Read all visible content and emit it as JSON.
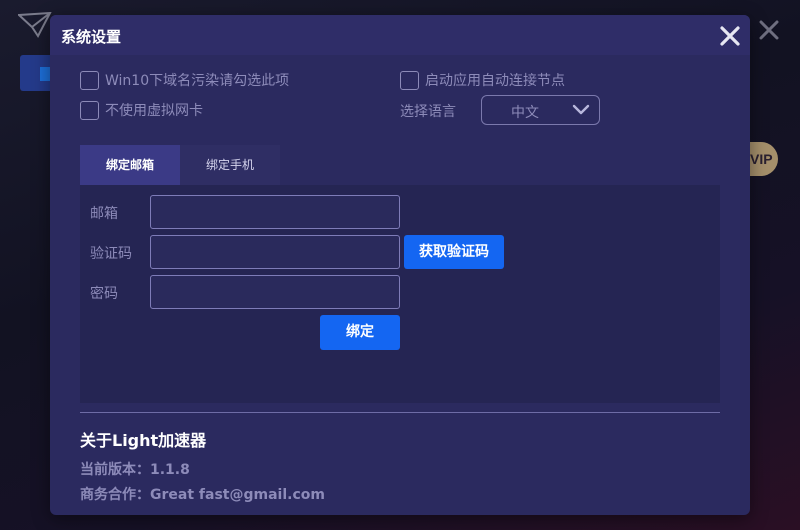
{
  "dialog": {
    "title": "系统设置"
  },
  "options": {
    "win10_fix": "Win10下域名污染请勾选此项",
    "auto_connect": "启动应用自动连接节点",
    "no_virtual_nic": "不使用虚拟网卡",
    "language_label": "选择语言",
    "language_value": "中文"
  },
  "tabs": {
    "email": "绑定邮箱",
    "phone": "绑定手机"
  },
  "form": {
    "email_label": "邮箱",
    "code_label": "验证码",
    "password_label": "密码",
    "get_code_button": "获取验证码",
    "bind_button": "绑定"
  },
  "about": {
    "title": "关于Light加速器",
    "version": "当前版本：1.1.8",
    "contact": "商务合作：Great fast@gmail.com"
  },
  "background": {
    "vip_badge": "VIP"
  },
  "colors": {
    "accent": "#1466f2",
    "dialog_bg": "#2b2a5f",
    "muted_text": "#8d8bb9"
  }
}
